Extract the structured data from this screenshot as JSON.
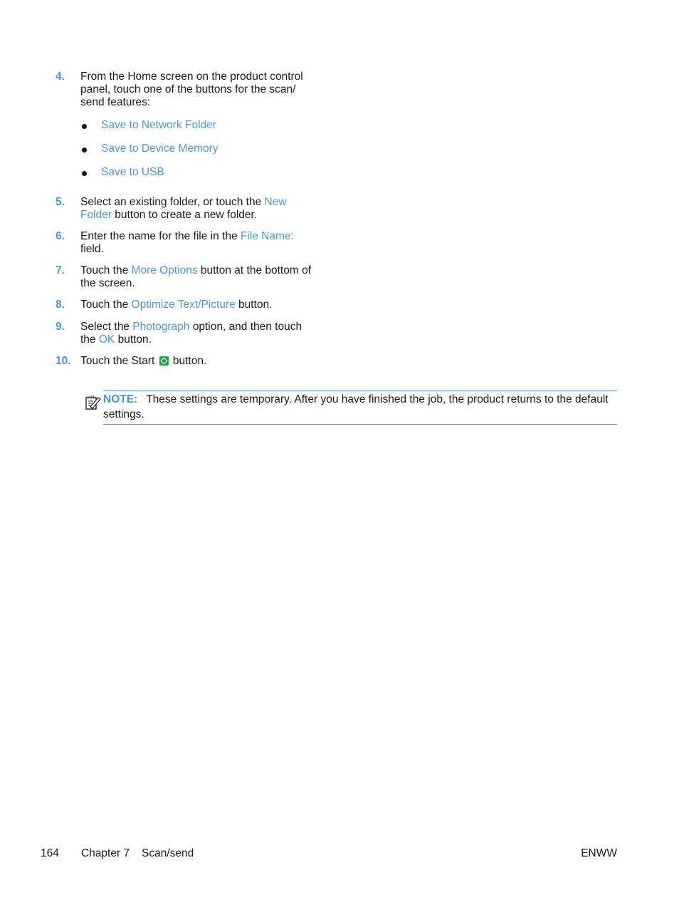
{
  "steps": [
    {
      "num": "4.",
      "parts": [
        "From the Home screen on the product control panel, touch one of the buttons for the scan/ send features:"
      ],
      "sub_items": [
        "Save to Network Folder",
        "Save to Device Memory",
        "Save to USB"
      ]
    },
    {
      "num": "5.",
      "text_a": "Select an existing folder, or touch the ",
      "link": "New Folder",
      "text_b": " button to create a new folder."
    },
    {
      "num": "6.",
      "text_a": "Enter the name for the file in the ",
      "link": "File Name:",
      "text_b": " field."
    },
    {
      "num": "7.",
      "text_a": "Touch the ",
      "link": "More Options",
      "text_b": " button at the bottom of the screen."
    },
    {
      "num": "8.",
      "text_a": "Touch the ",
      "link": "Optimize Text/Picture",
      "text_b": " button."
    },
    {
      "num": "9.",
      "text_a": "Select the ",
      "link": "Photograph",
      "text_b": " option, and then touch the ",
      "link2": "OK",
      "text_c": " button."
    },
    {
      "num": "10.",
      "text_a": "Touch the Start ",
      "icon": "start-button-icon",
      "text_b": " button."
    }
  ],
  "note": {
    "icon": "note-pencil-icon",
    "label": "NOTE:",
    "text": "These settings are temporary. After you have finished the job, the product returns to the default settings."
  },
  "footer": {
    "page_number": "164",
    "chapter": "Chapter 7",
    "section": "Scan/send",
    "locale": "ENWW"
  },
  "colors": {
    "accent": "#4f95cf",
    "start_icon": "#2e9e49"
  }
}
